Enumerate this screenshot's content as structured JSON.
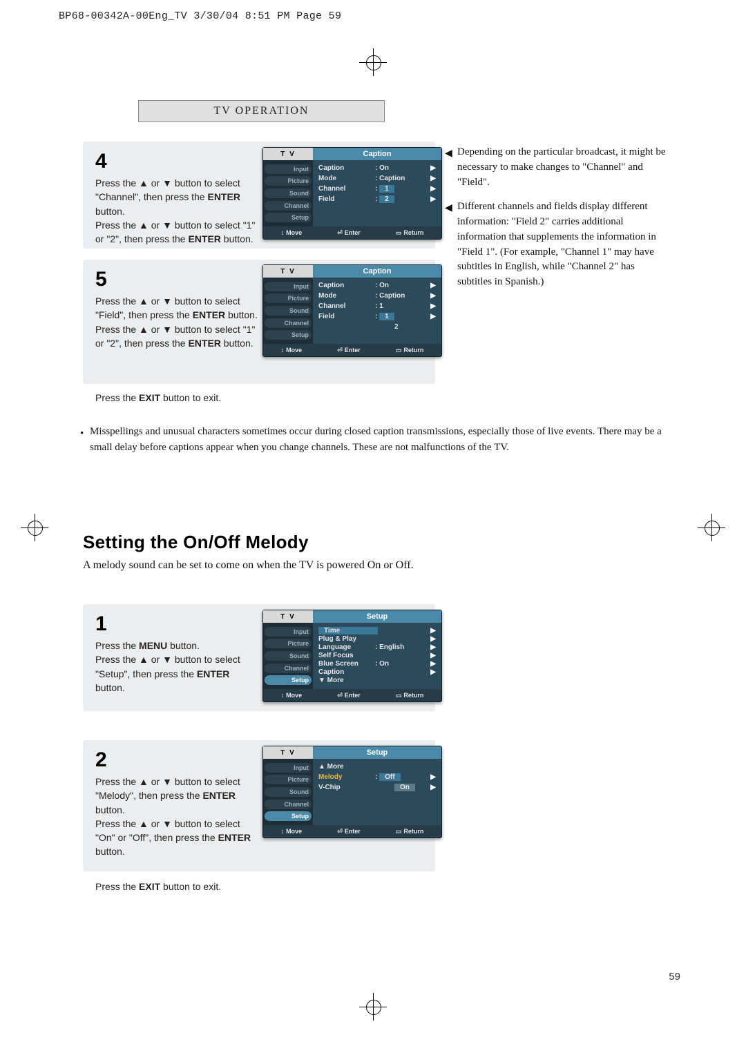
{
  "header_line": "BP68-00342A-00Eng_TV  3/30/04  8:51 PM  Page 59",
  "section_title": "TV  OPERATION",
  "page_number": "59",
  "steps": {
    "s4": {
      "num": "4",
      "p1_a": "Press the ▲ or ▼ button to select \"Channel\", then press the ",
      "p1_b": "ENTER",
      "p1_c": " button.",
      "p2_a": "Press the ▲ or ▼ button to select \"1\" or \"2\", then press the ",
      "p2_b": "ENTER",
      "p2_c": " button."
    },
    "s5": {
      "num": "5",
      "p1_a": "Press the ▲ or ▼ button to select \"Field\", then press the ",
      "p1_b": "ENTER",
      "p1_c": " button.",
      "p2_a": "Press the ▲ or ▼ button to select \"1\" or \"2\", then press the ",
      "p2_b": "ENTER",
      "p2_c": " button."
    },
    "s1": {
      "num": "1",
      "p1_a": "Press the ",
      "p1_b": "MENU",
      "p1_c": " button.",
      "p2_a": "Press the ▲ or ▼ button to select \"Setup\", then press the ",
      "p2_b": "ENTER",
      "p2_c": " button."
    },
    "s2": {
      "num": "2",
      "p1_a": "Press the ▲ or ▼ button to select \"Melody\", then press the ",
      "p1_b": "ENTER",
      "p1_c": " button.",
      "p2_a": "Press the ▲ or ▼ button to select \"On\" or \"Off\", then press the ",
      "p2_b": "ENTER",
      "p2_c": " button."
    }
  },
  "exit_line_a": "Press the ",
  "exit_line_b": "EXIT",
  "exit_line_c": " button to exit.",
  "side_note_1": "Depending on the particular broadcast, it might be necessary to make changes to \"Channel\" and \"Field\".",
  "side_note_2": "Different channels and fields display different information: \"Field 2\" carries additional information that supplements the information in \"Field 1\". (For example, \"Channel 1\" may have subtitles in English, while \"Channel 2\" has subtitles in Spanish.)",
  "bullet": "Misspellings and unusual characters sometimes occur during closed caption transmissions, especially those of live events. There may be a small delay before captions appear when you change channels. These are not malfunctions of the TV.",
  "heading2": "Setting the On/Off Melody",
  "heading_sub": "A melody sound can be set to come on when the TV is powered On or Off.",
  "osd": {
    "tv": "T V",
    "move": "Move",
    "enter": "Enter",
    "return": "Return",
    "tabs": {
      "input": "Input",
      "picture": "Picture",
      "sound": "Sound",
      "channel": "Channel",
      "setup": "Setup"
    },
    "caption": {
      "title": "Caption",
      "rows": [
        {
          "lbl": "Caption",
          "val": ":  On"
        },
        {
          "lbl": "Mode",
          "val": ":  Caption"
        },
        {
          "lbl": "Channel",
          "val": ":",
          "hl": "1"
        },
        {
          "lbl": "Field",
          "val": ":",
          "hl": "2"
        }
      ],
      "rows_field": [
        {
          "lbl": "Caption",
          "val": ":  On"
        },
        {
          "lbl": "Mode",
          "val": ":  Caption"
        },
        {
          "lbl": "Channel",
          "val": ":  1"
        },
        {
          "lbl": "Field",
          "val": ":",
          "hl": "1",
          "sub": "2"
        }
      ]
    },
    "setup": {
      "title": "Setup",
      "rows1": [
        {
          "lbl": "Time",
          "hl": true
        },
        {
          "lbl": "Plug & Play"
        },
        {
          "lbl": "Language",
          "val": ":  English"
        },
        {
          "lbl": "Self Focus"
        },
        {
          "lbl": "Blue Screen",
          "val": ":  On"
        },
        {
          "lbl": "Caption"
        },
        {
          "lbl": "▼ More"
        }
      ],
      "rows2": [
        {
          "lbl": "▲ More"
        },
        {
          "lbl": "Melody",
          "val": ":",
          "opt1": "Off",
          "opt2": "On"
        },
        {
          "lbl": "V-Chip"
        }
      ]
    }
  }
}
